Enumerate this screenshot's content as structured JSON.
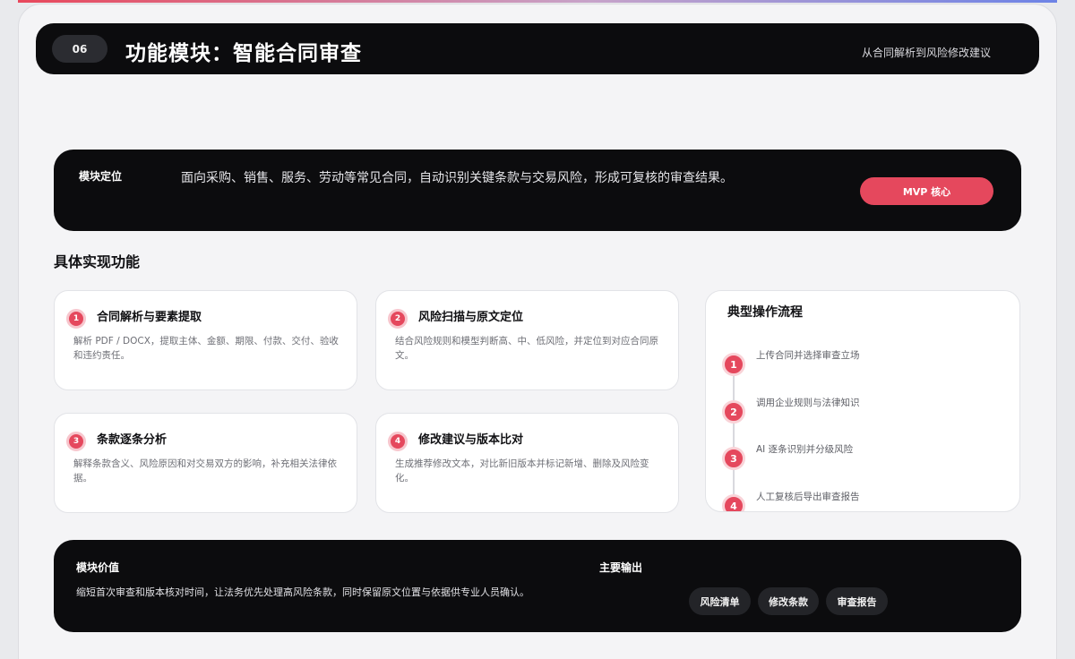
{
  "header": {
    "number": "06",
    "title": "功能模块：智能合同审查",
    "subtitle": "从合同解析到风险修改建议"
  },
  "positioning": {
    "label": "模块定位",
    "description": "面向采购、销售、服务、劳动等常见合同，自动识别关键条款与交易风险，形成可复核的审查结果。",
    "badge": "MVP 核心"
  },
  "features": {
    "section_title": "具体实现功能",
    "items": [
      {
        "num": "1",
        "title": "合同解析与要素提取",
        "desc": "解析 PDF / DOCX，提取主体、金额、期限、付款、交付、验收和违约责任。"
      },
      {
        "num": "2",
        "title": "风险扫描与原文定位",
        "desc": "结合风险规则和模型判断高、中、低风险，并定位到对应合同原文。"
      },
      {
        "num": "3",
        "title": "条款逐条分析",
        "desc": "解释条款含义、风险原因和对交易双方的影响，补充相关法律依据。"
      },
      {
        "num": "4",
        "title": "修改建议与版本比对",
        "desc": "生成推荐修改文本，对比新旧版本并标记新增、删除及风险变化。"
      }
    ]
  },
  "workflow": {
    "title": "典型操作流程",
    "steps": [
      {
        "num": "1",
        "text": "上传合同并选择审查立场"
      },
      {
        "num": "2",
        "text": "调用企业规则与法律知识"
      },
      {
        "num": "3",
        "text": "AI 逐条识别并分级风险"
      },
      {
        "num": "4",
        "text": "人工复核后导出审查报告"
      }
    ]
  },
  "value": {
    "label": "模块价值",
    "description": "缩短首次审查和版本核对时间，让法务优先处理高风险条款，同时保留原文位置与依据供专业人员确认。",
    "outputs_label": "主要输出",
    "outputs": [
      "风险清单",
      "修改条款",
      "审查报告"
    ]
  },
  "colors": {
    "accent": "#e5485d",
    "dark_panel": "#0c0c0e",
    "page_bg": "#f4f4f6"
  }
}
